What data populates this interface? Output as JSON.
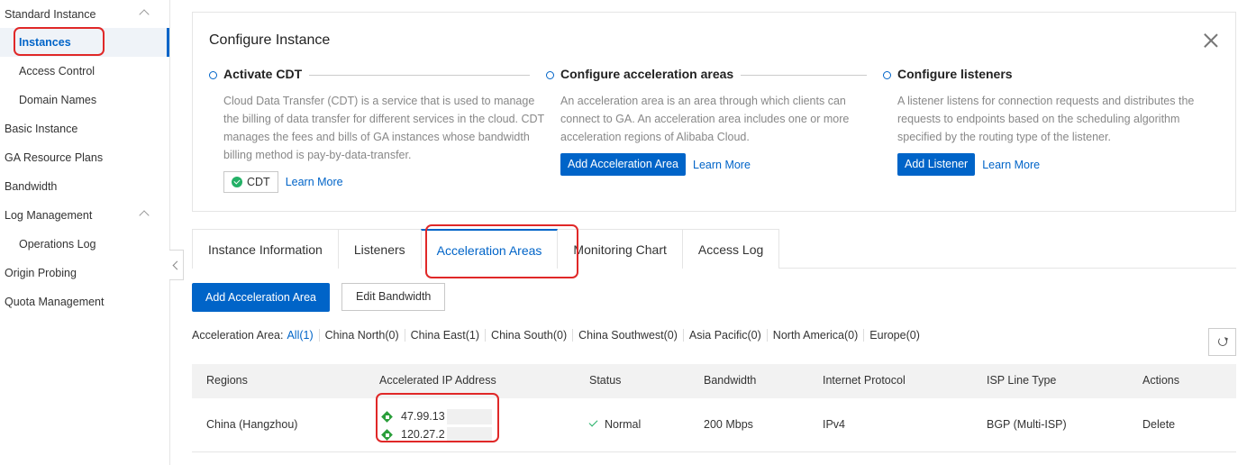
{
  "sidebar": {
    "items": [
      {
        "label": "Standard Instance"
      },
      {
        "label": "Instances"
      },
      {
        "label": "Access Control"
      },
      {
        "label": "Domain Names"
      },
      {
        "label": "Basic Instance"
      },
      {
        "label": "GA Resource Plans"
      },
      {
        "label": "Bandwidth"
      },
      {
        "label": "Log Management"
      },
      {
        "label": "Operations Log"
      },
      {
        "label": "Origin Probing"
      },
      {
        "label": "Quota Management"
      }
    ]
  },
  "config": {
    "title": "Configure Instance",
    "steps": [
      {
        "title": "Activate CDT",
        "desc": "Cloud Data Transfer (CDT) is a service that is used to manage the billing of data transfer for different services in the cloud. CDT manages the fees and bills of GA instances whose bandwidth billing method is pay-by-data-transfer.",
        "tag": "CDT",
        "link": "Learn More"
      },
      {
        "title": "Configure acceleration areas",
        "desc": "An acceleration area is an area through which clients can connect to GA. An acceleration area includes one or more acceleration regions of Alibaba Cloud.",
        "button": "Add Acceleration Area",
        "link": "Learn More"
      },
      {
        "title": "Configure listeners",
        "desc": "A listener listens for connection requests and distributes the requests to endpoints based on the scheduling algorithm specified by the routing type of the listener.",
        "button": "Add Listener",
        "link": "Learn More"
      }
    ]
  },
  "tabs": [
    {
      "label": "Instance Information"
    },
    {
      "label": "Listeners"
    },
    {
      "label": "Acceleration Areas"
    },
    {
      "label": "Monitoring Chart"
    },
    {
      "label": "Access Log"
    }
  ],
  "actions": {
    "add_area": "Add Acceleration Area",
    "edit_bandwidth": "Edit Bandwidth"
  },
  "filter": {
    "label": "Acceleration Area:",
    "options": [
      "All(1)",
      "China North(0)",
      "China East(1)",
      "China South(0)",
      "China Southwest(0)",
      "Asia Pacific(0)",
      "North America(0)",
      "Europe(0)"
    ]
  },
  "table": {
    "headers": [
      "Regions",
      "Accelerated IP Address",
      "Status",
      "Bandwidth",
      "Internet Protocol",
      "ISP Line Type",
      "Actions"
    ],
    "rows": [
      {
        "region": "China (Hangzhou)",
        "ips": [
          "47.99.13",
          "120.27.2"
        ],
        "status": "Normal",
        "bandwidth": "200 Mbps",
        "protocol": "IPv4",
        "isp": "BGP (Multi-ISP)",
        "action": "Delete"
      }
    ]
  }
}
